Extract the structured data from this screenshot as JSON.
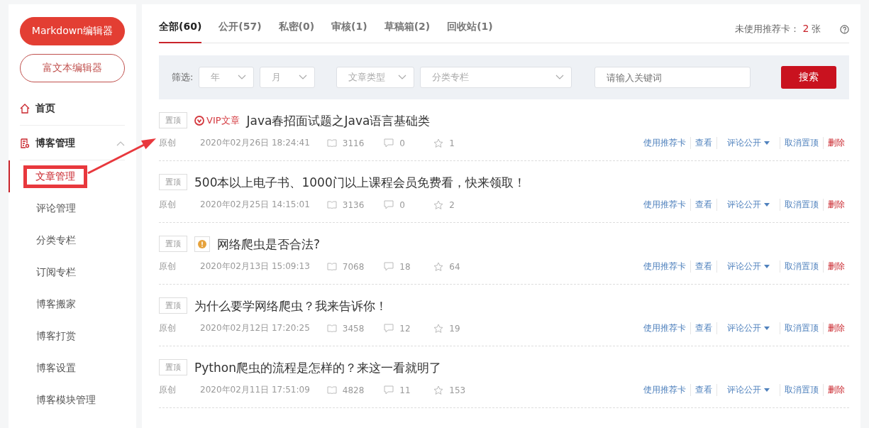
{
  "sidebar": {
    "buttons": [
      {
        "label": "Markdown编辑器",
        "kind": "primary"
      },
      {
        "label": "富文本编辑器",
        "kind": "outline"
      }
    ],
    "items": [
      {
        "label": "首页",
        "kind": "home"
      },
      {
        "label": "博客管理",
        "kind": "blog",
        "expanded": true,
        "children": [
          {
            "label": "文章管理",
            "selected": true
          },
          {
            "label": "评论管理",
            "selected": false
          },
          {
            "label": "分类专栏",
            "selected": false
          },
          {
            "label": "订阅专栏",
            "selected": false
          },
          {
            "label": "博客搬家",
            "selected": false
          },
          {
            "label": "博客打赏",
            "selected": false
          },
          {
            "label": "博客设置",
            "selected": false
          },
          {
            "label": "博客模块管理",
            "selected": false
          }
        ]
      }
    ]
  },
  "tabs": [
    {
      "label": "全部(60)",
      "selected": true
    },
    {
      "label": "公开(57)",
      "selected": false
    },
    {
      "label": "私密(0)",
      "selected": false
    },
    {
      "label": "审核(1)",
      "selected": false
    },
    {
      "label": "草稿箱(2)",
      "selected": false
    },
    {
      "label": "回收站(1)",
      "selected": false
    }
  ],
  "cards_info": {
    "label": "未使用推荐卡：",
    "count": "2",
    "unit": "张"
  },
  "filter": {
    "label": "筛选:",
    "selects": [
      {
        "placeholder": "年"
      },
      {
        "placeholder": "月"
      },
      {
        "placeholder": "文章类型"
      },
      {
        "placeholder": "分类专栏"
      }
    ],
    "search": {
      "placeholder": "请输入关键词"
    },
    "button": "搜索"
  },
  "articles": [
    {
      "pin": "置顶",
      "badge": {
        "kind": "vip",
        "label": "VIP文章"
      },
      "title": "Java春招面试题之Java语言基础类",
      "type": "原创",
      "date": "2020年02月26日 18:24:41",
      "reads": "3116",
      "comments": "0",
      "stars": "1",
      "actions": [
        {
          "label": "使用推荐卡",
          "kind": "link"
        },
        {
          "label": "查看",
          "kind": "link"
        },
        {
          "label": "评论公开",
          "kind": "dropdown"
        },
        {
          "label": "取消置顶",
          "kind": "link"
        },
        {
          "label": "删除",
          "kind": "danger"
        }
      ]
    },
    {
      "pin": "置顶",
      "title": "500本以上电子书、1000门以上课程会员免费看，快来领取！",
      "type": "原创",
      "date": "2020年02月25日 14:15:01",
      "reads": "3136",
      "comments": "0",
      "stars": "2",
      "actions": [
        {
          "label": "使用推荐卡",
          "kind": "link"
        },
        {
          "label": "查看",
          "kind": "link"
        },
        {
          "label": "评论公开",
          "kind": "dropdown"
        },
        {
          "label": "取消置顶",
          "kind": "link"
        },
        {
          "label": "删除",
          "kind": "danger"
        }
      ]
    },
    {
      "pin": "置顶",
      "badge": {
        "kind": "warning"
      },
      "title": "网络爬虫是否合法?",
      "type": "原创",
      "date": "2020年02月13日 15:09:13",
      "reads": "7068",
      "comments": "18",
      "stars": "64",
      "actions": [
        {
          "label": "使用推荐卡",
          "kind": "link"
        },
        {
          "label": "查看",
          "kind": "link"
        },
        {
          "label": "评论公开",
          "kind": "dropdown"
        },
        {
          "label": "取消置顶",
          "kind": "link"
        },
        {
          "label": "删除",
          "kind": "danger"
        }
      ]
    },
    {
      "pin": "置顶",
      "title": "为什么要学网络爬虫？我来告诉你！",
      "type": "原创",
      "date": "2020年02月12日 17:20:25",
      "reads": "3458",
      "comments": "12",
      "stars": "19",
      "actions": [
        {
          "label": "使用推荐卡",
          "kind": "link"
        },
        {
          "label": "查看",
          "kind": "link"
        },
        {
          "label": "评论公开",
          "kind": "dropdown"
        },
        {
          "label": "取消置顶",
          "kind": "link"
        },
        {
          "label": "删除",
          "kind": "danger"
        }
      ]
    },
    {
      "pin": "置顶",
      "title": "Python爬虫的流程是怎样的？来这一看就明了",
      "type": "原创",
      "date": "2020年02月11日 17:51:09",
      "reads": "4828",
      "comments": "11",
      "stars": "153",
      "actions": [
        {
          "label": "使用推荐卡",
          "kind": "link"
        },
        {
          "label": "查看",
          "kind": "link"
        },
        {
          "label": "评论公开",
          "kind": "dropdown"
        },
        {
          "label": "取消置顶",
          "kind": "link"
        },
        {
          "label": "删除",
          "kind": "danger"
        }
      ]
    }
  ]
}
